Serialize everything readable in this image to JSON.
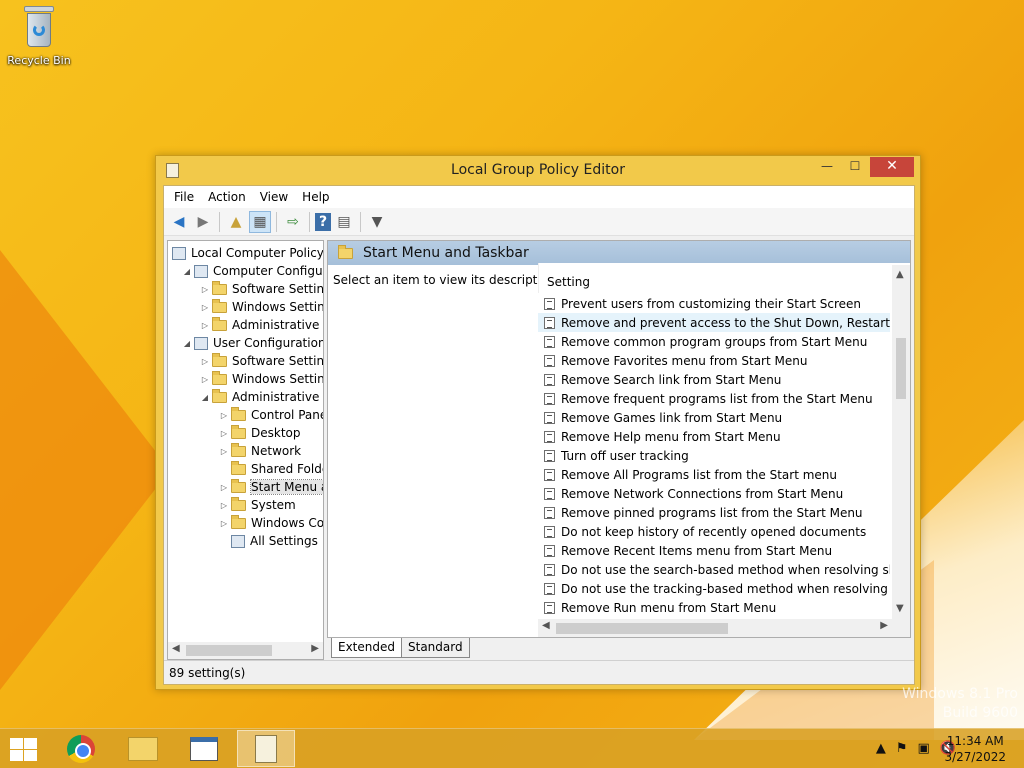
{
  "desktop": {
    "recycle_bin_label": "Recycle Bin",
    "watermark_line1": "Windows 8.1 Pro",
    "watermark_line2": "Build 9600"
  },
  "window": {
    "title": "Local Group Policy Editor",
    "menu": [
      "File",
      "Action",
      "View",
      "Help"
    ],
    "tree": [
      {
        "label": "Local Computer Policy",
        "level": 0,
        "expander": "",
        "icon": "policy-icon"
      },
      {
        "label": "Computer Configura",
        "level": 1,
        "expander": "◢",
        "icon": "computer-icon"
      },
      {
        "label": "Software Settings",
        "level": 2,
        "expander": "▷",
        "icon": "folder-icon"
      },
      {
        "label": "Windows Setting",
        "level": 2,
        "expander": "▷",
        "icon": "folder-icon"
      },
      {
        "label": "Administrative Te",
        "level": 2,
        "expander": "▷",
        "icon": "folder-icon"
      },
      {
        "label": "User Configuration",
        "level": 1,
        "expander": "◢",
        "icon": "user-icon"
      },
      {
        "label": "Software Settings",
        "level": 2,
        "expander": "▷",
        "icon": "folder-icon"
      },
      {
        "label": "Windows Setting",
        "level": 2,
        "expander": "▷",
        "icon": "folder-icon"
      },
      {
        "label": "Administrative Te",
        "level": 2,
        "expander": "◢",
        "icon": "folder-icon"
      },
      {
        "label": "Control Panel",
        "level": 3,
        "expander": "▷",
        "icon": "folder-icon"
      },
      {
        "label": "Desktop",
        "level": 3,
        "expander": "▷",
        "icon": "folder-icon"
      },
      {
        "label": "Network",
        "level": 3,
        "expander": "▷",
        "icon": "folder-icon"
      },
      {
        "label": "Shared Folder",
        "level": 3,
        "expander": "",
        "icon": "folder-icon"
      },
      {
        "label": "Start Menu ar",
        "level": 3,
        "expander": "▷",
        "icon": "folder-icon",
        "selected": true
      },
      {
        "label": "System",
        "level": 3,
        "expander": "▷",
        "icon": "folder-icon"
      },
      {
        "label": "Windows Cor",
        "level": 3,
        "expander": "▷",
        "icon": "folder-icon"
      },
      {
        "label": "All Settings",
        "level": 3,
        "expander": "",
        "icon": "settings-icon"
      }
    ],
    "right_header": "Start Menu and Taskbar",
    "description": "Select an item to view its description.",
    "column_header": "Setting",
    "settings": [
      "Prevent users from customizing their Start Screen",
      "Remove and prevent access to the Shut Down, Restart, Sleep...",
      "Remove common program groups from Start Menu",
      "Remove Favorites menu from Start Menu",
      "Remove Search link from Start Menu",
      "Remove frequent programs list from the Start Menu",
      "Remove Games link from Start Menu",
      "Remove Help menu from Start Menu",
      "Turn off user tracking",
      "Remove All Programs list from the Start menu",
      "Remove Network Connections from Start Menu",
      "Remove pinned programs list from the Start Menu",
      "Do not keep history of recently opened documents",
      "Remove Recent Items menu from Start Menu",
      "Do not use the search-based method when resolving shell s...",
      "Do not use the tracking-based method when resolving shell ...",
      "Remove Run menu from Start Menu"
    ],
    "selected_setting_index": 1,
    "tabs": [
      "Extended",
      "Standard"
    ],
    "status": "89 setting(s)"
  },
  "taskbar": {
    "time": "11:34 AM",
    "date": "3/27/2022"
  }
}
